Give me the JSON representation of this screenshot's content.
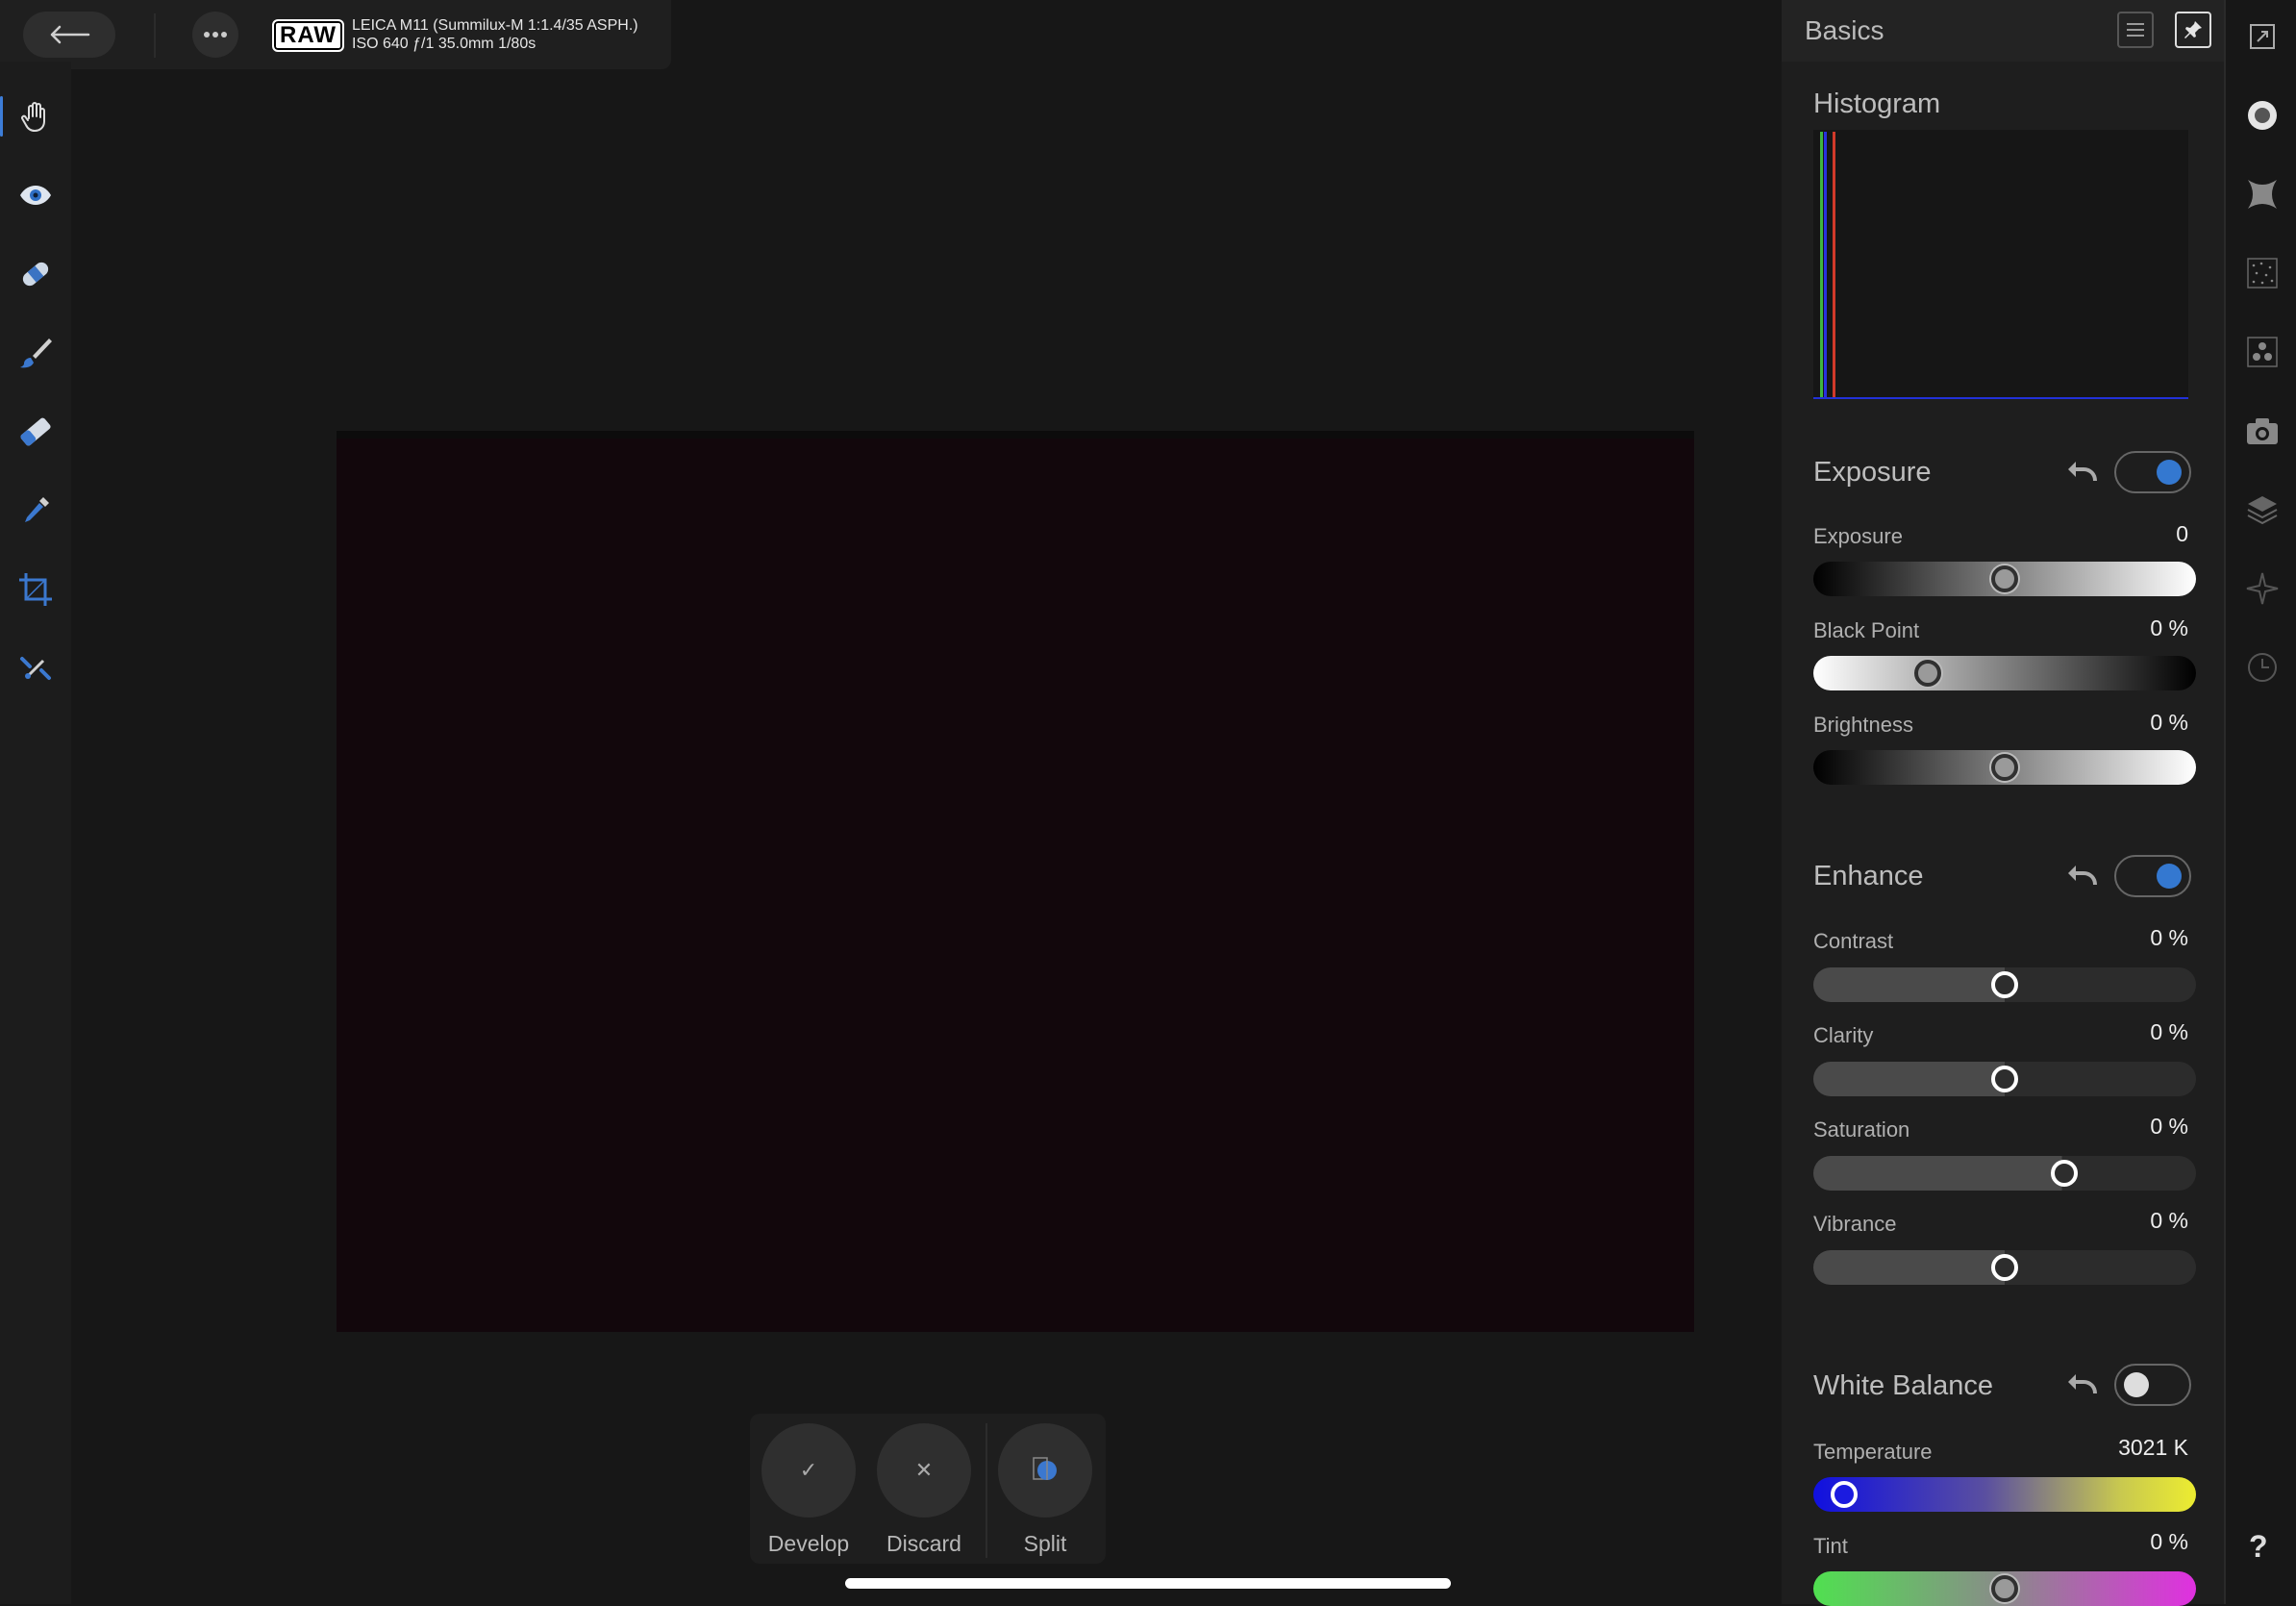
{
  "topbar": {
    "raw_badge": "RAW",
    "camera_line1": "LEICA M11 (Summilux-M 1:1.4/35 ASPH.)",
    "camera_line2": "ISO 640 ƒ/1 35.0mm 1/80s"
  },
  "tools": [
    {
      "name": "hand-tool",
      "icon": "hand-icon"
    },
    {
      "name": "red-eye-tool",
      "icon": "eye-icon"
    },
    {
      "name": "blemish-removal-tool",
      "icon": "bandage-icon"
    },
    {
      "name": "overlay-paint-tool",
      "icon": "brush-icon"
    },
    {
      "name": "overlay-gradient-tool",
      "icon": "gradient-icon"
    },
    {
      "name": "white-balance-tool",
      "icon": "eyedropper-icon"
    },
    {
      "name": "crop-tool",
      "icon": "crop-icon"
    },
    {
      "name": "straighten-tool",
      "icon": "straighten-icon"
    }
  ],
  "actions": {
    "develop": "Develop",
    "discard": "Discard",
    "split": "Split"
  },
  "panel": {
    "title": "Basics",
    "histogram": {
      "title": "Histogram",
      "colors": {
        "green": "#3fb43f",
        "blue": "#2830e0",
        "red": "#d13a2a"
      }
    },
    "exposure": {
      "title": "Exposure",
      "enabled": true,
      "sliders": {
        "exposure": {
          "label": "Exposure",
          "value": "0",
          "position": 0.5
        },
        "black_point": {
          "label": "Black Point",
          "value": "0 %",
          "position": 0.3
        },
        "brightness": {
          "label": "Brightness",
          "value": "0 %",
          "position": 0.5
        }
      }
    },
    "enhance": {
      "title": "Enhance",
      "enabled": true,
      "sliders": {
        "contrast": {
          "label": "Contrast",
          "value": "0 %",
          "position": 0.5
        },
        "clarity": {
          "label": "Clarity",
          "value": "0 %",
          "position": 0.5
        },
        "saturation": {
          "label": "Saturation",
          "value": "0 %",
          "position": 0.655
        },
        "vibrance": {
          "label": "Vibrance",
          "value": "0 %",
          "position": 0.5
        }
      }
    },
    "white_balance": {
      "title": "White Balance",
      "enabled": false,
      "sliders": {
        "temperature": {
          "label": "Temperature",
          "value": "3021 K",
          "position": 0.08
        },
        "tint": {
          "label": "Tint",
          "value": "0 %",
          "position": 0.5
        }
      }
    }
  },
  "rail": {
    "icons": [
      "tone-icon",
      "vignette-icon",
      "noise-icon",
      "color-balance-icon",
      "lens-icon",
      "layers-icon",
      "sparkle-icon",
      "history-icon"
    ],
    "help": "?"
  },
  "colors": {
    "accent": "#3478d0",
    "photo_fill": "#12070c"
  }
}
